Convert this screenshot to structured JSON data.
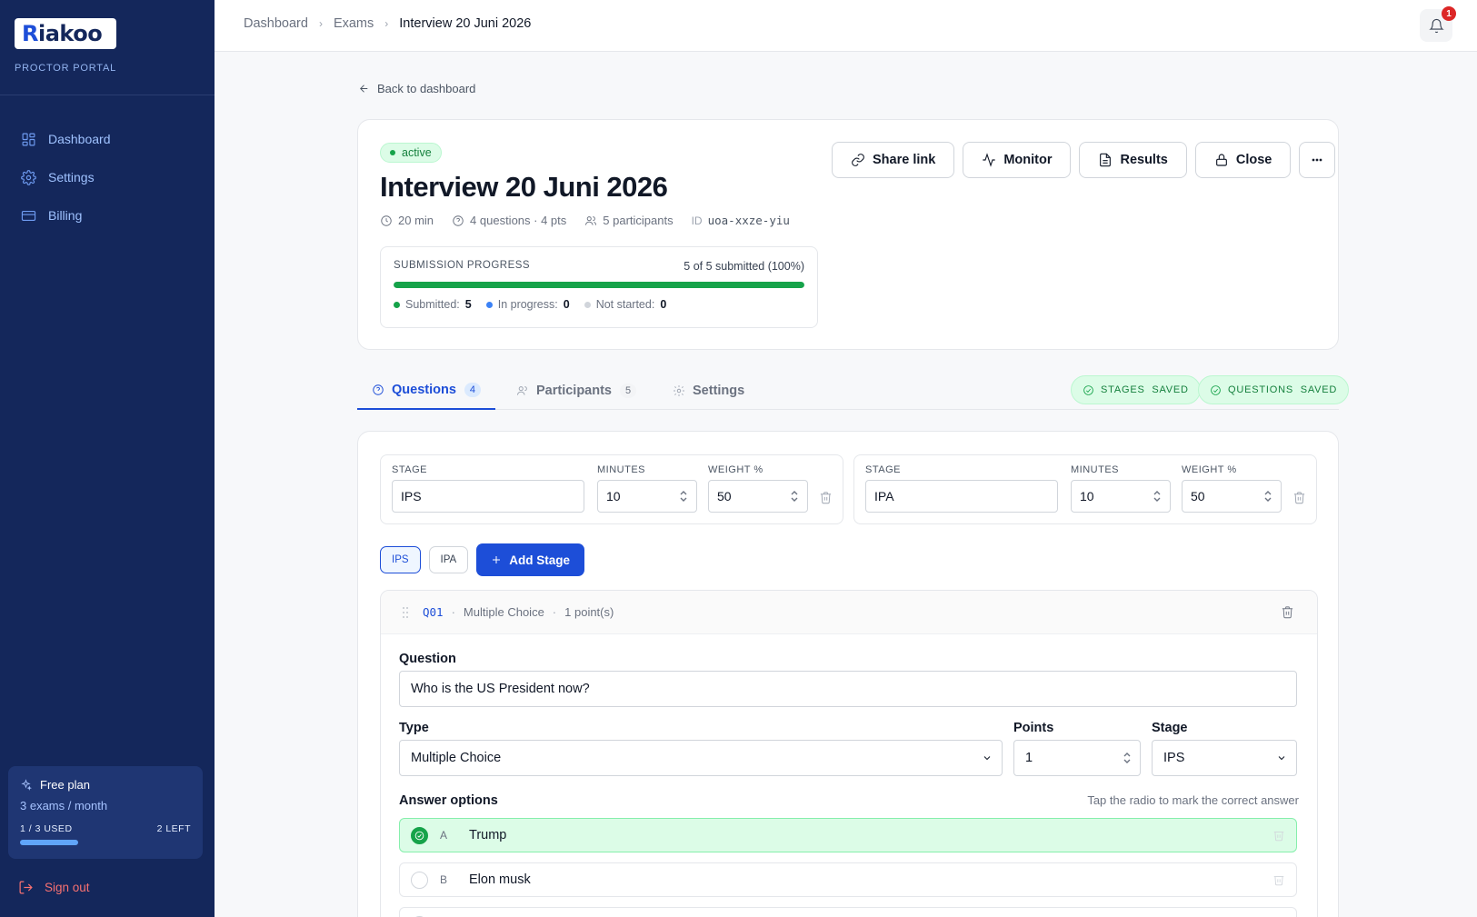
{
  "app": {
    "brand_main": "Riakoo",
    "portal_label": "PROCTOR PORTAL"
  },
  "sidebar": {
    "items": [
      {
        "label": "Dashboard",
        "icon": "grid-icon"
      },
      {
        "label": "Settings",
        "icon": "gear-icon"
      },
      {
        "label": "Billing",
        "icon": "credit-card-icon"
      }
    ],
    "plan": {
      "title": "Free plan",
      "quota": "3 exams / month",
      "used_label": "1 / 3 USED",
      "left_label": "2 LEFT",
      "used_fraction": 0.333
    },
    "signout_label": "Sign out"
  },
  "topbar": {
    "breadcrumb": [
      "Dashboard",
      "Exams",
      "Interview 20 Juni 2026"
    ],
    "notification_count": "1"
  },
  "back_link": "Back to dashboard",
  "exam": {
    "status": "active",
    "title": "Interview 20 Juni 2026",
    "duration": "20 min",
    "questions_summary": "4 questions · 4 pts",
    "participants_summary": "5 participants",
    "id_label": "ID",
    "id_value": "uoa-xxze-yiu",
    "progress": {
      "label": "SUBMISSION PROGRESS",
      "summary": "5 of 5 submitted (100%)",
      "fraction": 1.0,
      "submitted_label": "Submitted:",
      "submitted_value": "5",
      "in_progress_label": "In progress:",
      "in_progress_value": "0",
      "not_started_label": "Not started:",
      "not_started_value": "0"
    },
    "actions": {
      "share": "Share link",
      "monitor": "Monitor",
      "results": "Results",
      "close": "Close"
    }
  },
  "tabs": [
    {
      "label": "Questions",
      "count": "4"
    },
    {
      "label": "Participants",
      "count": "5"
    },
    {
      "label": "Settings",
      "count": ""
    }
  ],
  "saved": {
    "stages": "STAGES  SAVED",
    "questions": "QUESTIONS  SAVED"
  },
  "stages_editor": {
    "labels": {
      "stage": "STAGE",
      "minutes": "MINUTES",
      "weight": "WEIGHT %"
    },
    "stages": [
      {
        "name": "IPS",
        "minutes": "10",
        "weight": "50"
      },
      {
        "name": "IPA",
        "minutes": "10",
        "weight": "50"
      }
    ],
    "add_stage_label": "Add Stage"
  },
  "question": {
    "id": "Q01",
    "type_summary": "Multiple Choice",
    "points_summary": "1 point(s)",
    "question_label": "Question",
    "question_text": "Who is the US President now?",
    "type_label": "Type",
    "type_value": "Multiple Choice",
    "points_label": "Points",
    "points_value": "1",
    "stage_label": "Stage",
    "stage_value": "IPS",
    "answers_label": "Answer options",
    "answers_hint": "Tap the radio to mark the correct answer",
    "options": [
      {
        "letter": "A",
        "text": "Trump",
        "correct": true
      },
      {
        "letter": "B",
        "text": "Elon musk",
        "correct": false
      }
    ]
  },
  "colors": {
    "sidebar_bg": "#14275b",
    "accent": "#1d4ed8",
    "success": "#16a34a",
    "danger": "#dc2626"
  }
}
